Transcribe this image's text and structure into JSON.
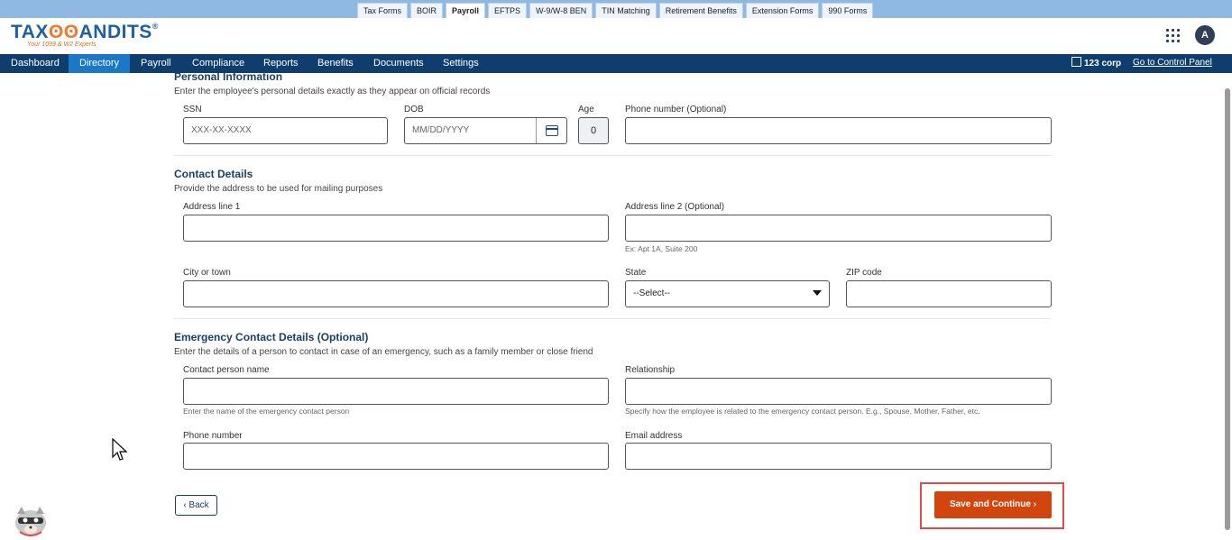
{
  "product_tabs": [
    "Tax Forms",
    "BOIR",
    "Payroll",
    "EFTPS",
    "W-9/W-8 BEN",
    "TIN Matching",
    "Retirement Benefits",
    "Extension Forms",
    "990 Forms"
  ],
  "active_product_tab": "Payroll",
  "logo": {
    "text_a": "TAX",
    "text_b": "ANDITS",
    "reg": "®",
    "tagline": "Your 1099 & W2 Experts"
  },
  "user": {
    "avatar_initial": "A"
  },
  "nav": {
    "items": [
      "Dashboard",
      "Directory",
      "Payroll",
      "Compliance",
      "Reports",
      "Benefits",
      "Documents",
      "Settings"
    ],
    "active": "Directory",
    "company": "123 corp",
    "control_panel_link": "Go to Control Panel"
  },
  "personal": {
    "title": "Personal Information",
    "desc": "Enter the employee's personal details exactly as they appear on official records",
    "ssn_label": "SSN",
    "ssn_placeholder": "XXX-XX-XXXX",
    "dob_label": "DOB",
    "dob_placeholder": "MM/DD/YYYY",
    "age_label": "Age",
    "age_value": "0",
    "phone_label": "Phone number (Optional)"
  },
  "contact": {
    "title": "Contact Details",
    "desc": "Provide the address to be used for mailing purposes",
    "address1_label": "Address line 1",
    "address2_label": "Address line 2 (Optional)",
    "address2_help": "Ex: Apt 1A, Suite 200",
    "city_label": "City or town",
    "state_label": "State",
    "state_value": "--Select--",
    "zip_label": "ZIP code"
  },
  "emergency": {
    "title": "Emergency Contact Details (Optional)",
    "desc": "Enter the details of a person to contact in case of an emergency, such as a family member or close friend",
    "name_label": "Contact person name",
    "name_help": "Enter the name of the emergency contact person",
    "relationship_label": "Relationship",
    "relationship_help": "Specify how the employee is related to the emergency contact person. E.g., Spouse, Mother, Father, etc.",
    "phone_label": "Phone number",
    "email_label": "Email address"
  },
  "actions": {
    "back_label": "‹ Back",
    "save_label": "Save and Continue ›"
  },
  "colors": {
    "nav_bg": "#0f3e6e",
    "nav_active": "#1b78c8",
    "save_btn": "#d1460f",
    "highlight": "#e04b4b"
  }
}
